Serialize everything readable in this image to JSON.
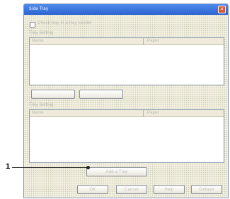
{
  "dialog": {
    "title": "Side Tray",
    "close_glyph": "✕"
  },
  "options": {
    "checkbox_label": "Check tray in a tray sender"
  },
  "group_top": {
    "label": "Tray Setting",
    "columns": [
      "Name",
      "Paper"
    ]
  },
  "group_bottom": {
    "label": "Tray Setting",
    "columns": [
      "Name",
      "Paper"
    ]
  },
  "buttons": {
    "add_label": "",
    "remove_label": "",
    "add_tray_label": "Add a Tray",
    "ok_label": "OK",
    "cancel_label": "Cancel",
    "help_label": "Help",
    "default_label": "Default"
  },
  "callout": {
    "number": "1"
  },
  "colors": {
    "titlebar": "#2b63cf",
    "close_button": "#d9532c",
    "dialog_face": "#f4f1e2"
  }
}
